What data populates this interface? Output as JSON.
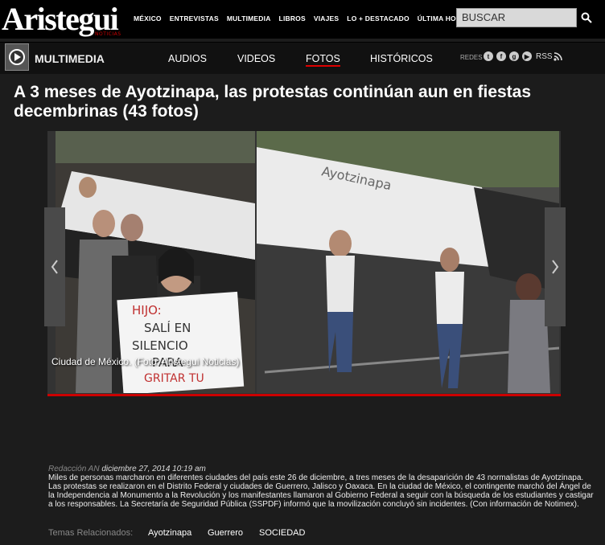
{
  "header": {
    "logo": "Aristegui",
    "logo_sub": "NOTICIAS",
    "nav": [
      "MÉXICO",
      "ENTREVISTAS",
      "MULTIMEDIA",
      "LIBROS",
      "VIAJES",
      "LO + DESTACADO",
      "ÚLTIMA HORA"
    ],
    "search_placeholder": "BUSCAR"
  },
  "section": {
    "title": "MULTIMEDIA",
    "nav": [
      "AUDIOS",
      "VIDEOS",
      "FOTOS",
      "HISTÓRICOS"
    ],
    "active": "FOTOS",
    "redes_label": "REDES",
    "social_icons": [
      "twitter-icon",
      "facebook-icon",
      "googleplus-icon",
      "youtube-icon"
    ],
    "rss_label": "RSS"
  },
  "article": {
    "headline": "A 3 meses de Ayotzinapa, las protestas continúan aun en fiestas decembrinas (43 fotos)",
    "caption": "Ciudad de México. (Foto: Aristegui Noticias)",
    "sign_text": "HIJO: SALÍ EN SILENCIO PARA GRITAR TU LIBERTAD",
    "byline": "Redacción AN",
    "date": "diciembre 27, 2014 10:19 am",
    "body": "Miles de personas marcharon en diferentes ciudades del país este 26 de diciembre, a tres meses de la desaparición de 43 normalistas de Ayotzinapa. Las protestas se realizaron en el Distrito Federal y ciudades de Guerrero, Jalisco y Oaxaca. En la ciudad de México, el contingente marchó del Ángel de la Independencia al Monumento a la Revolución y los manifestantes llamaron al Gobierno Federal a seguir con la búsqueda de los estudiantes y castigar a los responsables. La Secretaría de Seguridad Pública (SSPDF) informó que la movilización concluyó sin incidentes. (Con información de Notimex).",
    "tags_label": "Temas Relacionados:",
    "tags": [
      "Ayotzinapa",
      "Guerrero",
      "SOCIEDAD"
    ]
  }
}
